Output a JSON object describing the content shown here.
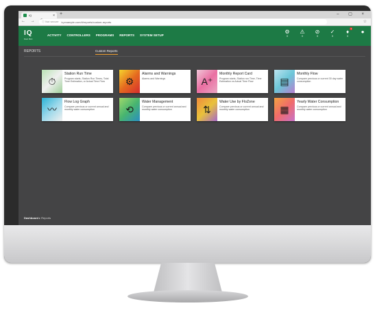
{
  "browser": {
    "tab_title": "IQ",
    "tab_close": "×",
    "new_tab": "+",
    "window_controls": "– ▢ ×",
    "nav_arrows": "← → C",
    "security": "ⓘ Not secure",
    "url": "iq.example.com/#/reports/custom-reports",
    "star": "☆"
  },
  "app": {
    "logo": "IQ",
    "logo_sub": "Rain Bird",
    "nav": [
      "ACTIVITY",
      "CONTROLLERS",
      "PROGRAMS",
      "REPORTS",
      "SYSTEM SETUP"
    ],
    "header_icons": [
      {
        "name": "weather-icon",
        "glyph": "⚙",
        "caption": "0"
      },
      {
        "name": "alarm-icon",
        "glyph": "⚠",
        "caption": "0"
      },
      {
        "name": "alert-icon",
        "glyph": "⊘",
        "caption": "0"
      },
      {
        "name": "status-icon",
        "glyph": "✓",
        "caption": "0"
      },
      {
        "name": "notification-icon",
        "glyph": "♦",
        "caption": "0",
        "badge": "3"
      },
      {
        "name": "user-icon",
        "glyph": "●",
        "caption": ""
      }
    ]
  },
  "page": {
    "title": "REPORTS",
    "active_tab": "Custom Reports"
  },
  "cards": [
    {
      "title": "Station Run Time",
      "desc": "Program starts, Station Run Times, Total Time Estimation, or Actual Time Flow",
      "icon": "⏱",
      "icon_name": "stopwatch-icon"
    },
    {
      "title": "Alarms and Warnings",
      "desc": "Alarms and Warnings",
      "icon": "⚙",
      "icon_name": "alarm-gear-icon"
    },
    {
      "title": "Monthly Report Card",
      "desc": "Program starts, Station run Time, Time Estimation vs Actual Time Flow",
      "icon": "A⁺",
      "icon_name": "grade-icon"
    },
    {
      "title": "Monthly Flow",
      "desc": "Compare previous or current 30 day water consumption",
      "icon": "▤",
      "icon_name": "calendar-icon"
    },
    {
      "title": "Flow Log Graph",
      "desc": "Compare previous or current annual and monthly water consumption",
      "icon": "〰",
      "icon_name": "line-graph-icon"
    },
    {
      "title": "Water Management",
      "desc": "Compare previous or current annual and monthly water consumption",
      "icon": "⟲",
      "icon_name": "water-management-icon"
    },
    {
      "title": "Water Use by FloZone",
      "desc": "Compare previous or current annual and monthly water consumption",
      "icon": "⇅",
      "icon_name": "flow-arrows-icon"
    },
    {
      "title": "Yearly Water Consumption",
      "desc": "Compare previous or current annual and monthly water consumption",
      "icon": "▦",
      "icon_name": "calendar-grid-icon"
    }
  ],
  "footer": {
    "dashboard": "Dashboard",
    "sep": "▸",
    "current": "Reports"
  }
}
